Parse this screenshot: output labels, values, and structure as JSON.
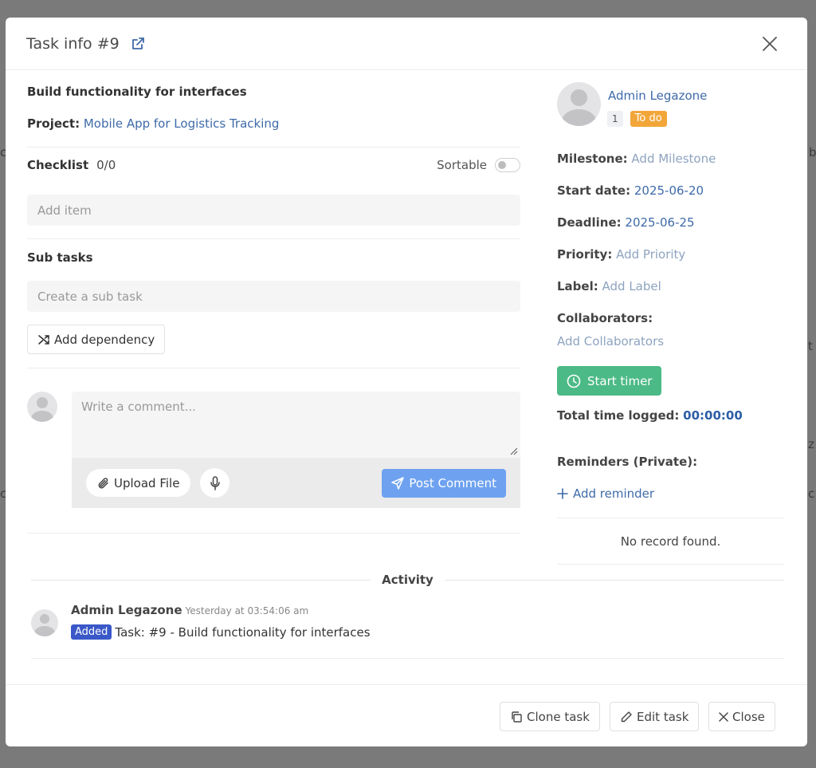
{
  "modal": {
    "title": "Task info #9"
  },
  "task": {
    "title": "Build functionality for interfaces",
    "project_label": "Project:",
    "project_name": "Mobile App for Logistics Tracking"
  },
  "checklist": {
    "label": "Checklist",
    "count": "0/0",
    "sortable_label": "Sortable",
    "sortable_on": false,
    "add_item_placeholder": "Add item"
  },
  "subtasks": {
    "label": "Sub tasks",
    "create_placeholder": "Create a sub task",
    "add_dependency_label": "Add dependency"
  },
  "comment": {
    "placeholder": "Write a comment...",
    "upload_label": "Upload File",
    "post_label": "Post Comment"
  },
  "activity": {
    "heading": "Activity",
    "items": [
      {
        "user": "Admin Legazone",
        "time": "Yesterday at 03:54:06 am",
        "badge": "Added",
        "text": "Task: #9 - Build functionality for interfaces"
      }
    ]
  },
  "sidebar": {
    "owner_name": "Admin Legazone",
    "owner_badge_num": "1",
    "status_badge": "To do",
    "milestone_label": "Milestone:",
    "milestone_value": "Add Milestone",
    "start_label": "Start date:",
    "start_value": "2025-06-20",
    "deadline_label": "Deadline:",
    "deadline_value": "2025-06-25",
    "priority_label": "Priority:",
    "priority_value": "Add Priority",
    "label_label": "Label:",
    "label_value": "Add Label",
    "collaborators_label": "Collaborators:",
    "collaborators_value": "Add Collaborators",
    "timer_label": "Start timer",
    "total_time_label": "Total time logged:",
    "total_time_value": "00:00:00",
    "reminders_label": "Reminders (Private):",
    "add_reminder_label": "Add reminder",
    "reminders_empty": "No record found."
  },
  "footer": {
    "clone_label": "Clone task",
    "edit_label": "Edit task",
    "close_label": "Close"
  },
  "colors": {
    "accent": "#3e6aa8",
    "timer_green": "#4cba86",
    "post_blue": "#6ea2f0",
    "todo_orange": "#f2a63a",
    "added_badge": "#3a58c8"
  }
}
